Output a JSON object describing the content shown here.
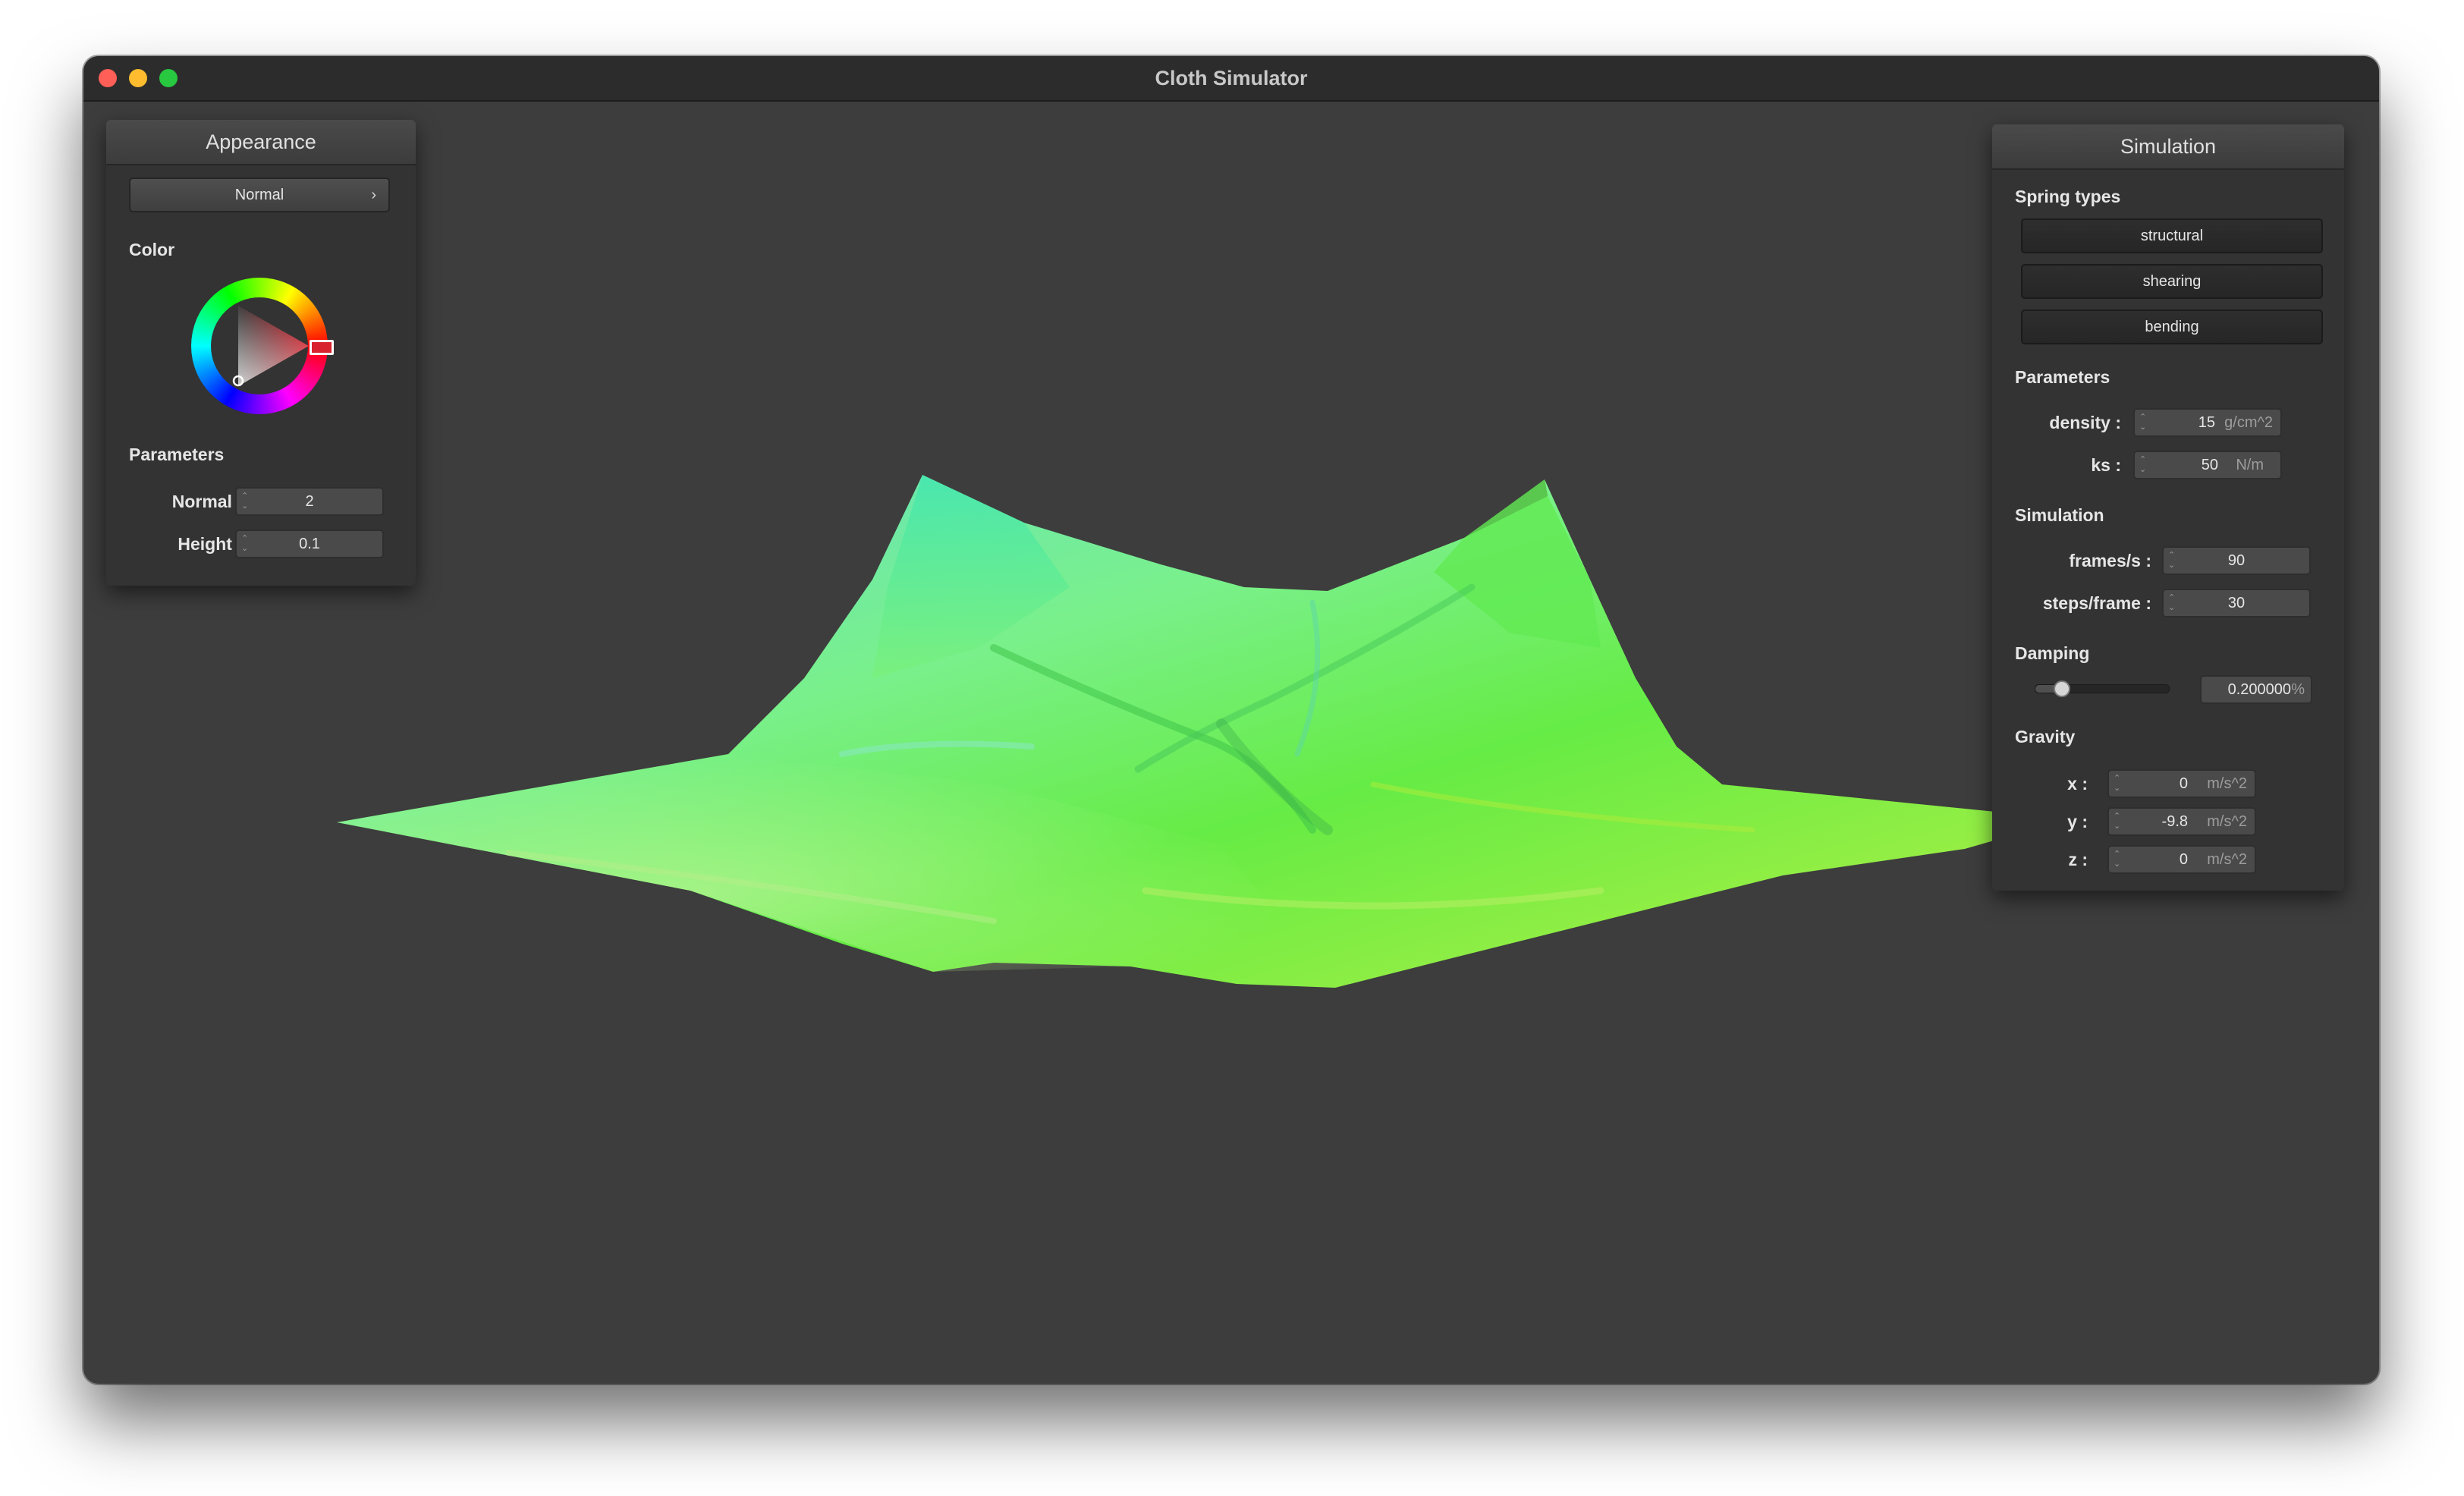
{
  "window": {
    "title": "Cloth Simulator"
  },
  "appearance": {
    "title": "Appearance",
    "shader_select": "Normal",
    "color_label": "Color",
    "color_value": "#d8232e",
    "params_label": "Parameters",
    "normal": {
      "label": "Normal :",
      "value": "2"
    },
    "height": {
      "label": "Height :",
      "value": "0.1"
    }
  },
  "simulation": {
    "title": "Simulation",
    "spring_types_label": "Spring types",
    "spring_types": [
      "structural",
      "shearing",
      "bending"
    ],
    "params_label": "Parameters",
    "density": {
      "label": "density :",
      "value": "15",
      "unit": "g/cm^2"
    },
    "ks": {
      "label": "ks :",
      "value": "50",
      "unit": "N/m"
    },
    "sim_label": "Simulation",
    "fps": {
      "label": "frames/s :",
      "value": "90"
    },
    "steps": {
      "label": "steps/frame :",
      "value": "30"
    },
    "damping_label": "Damping",
    "damping": {
      "value": "0.200000",
      "unit": "%",
      "slider_fraction": 0.2
    },
    "gravity_label": "Gravity",
    "gravity": [
      {
        "label": "x :",
        "value": "0",
        "unit": "m/s^2"
      },
      {
        "label": "y :",
        "value": "-9.8",
        "unit": "m/s^2"
      },
      {
        "label": "z :",
        "value": "0",
        "unit": "m/s^2"
      }
    ]
  },
  "colors": {
    "cloth_light": "#9ff57a",
    "cloth_cyan": "#5fe8c8",
    "cloth_green": "#66ec45"
  }
}
